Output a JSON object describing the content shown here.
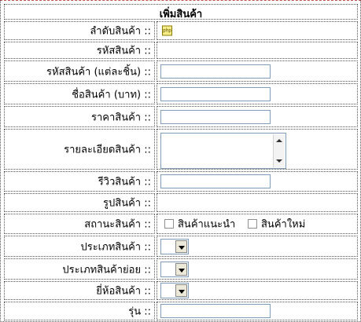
{
  "form": {
    "title": "เพิ่มสินค้า",
    "separator": "::",
    "fields": {
      "order_no": {
        "label": "ลำดับสินค้า",
        "icon": "php-icon"
      },
      "product_code": {
        "label": "รหัสสินค้า"
      },
      "product_code_each": {
        "label": "รหัสสินค้า (แต่ละชิ้น)",
        "value": ""
      },
      "product_name": {
        "label": "ชื่อสินค้า (บาท)",
        "value": ""
      },
      "price": {
        "label": "ราคาสินค้า",
        "value": ""
      },
      "details": {
        "label": "รายละเอียดสินค้า",
        "value": ""
      },
      "review": {
        "label": "รีวิวสินค้า",
        "value": ""
      },
      "image": {
        "label": "รูปสินค้า"
      },
      "status": {
        "label": "สถานะสินค้า",
        "options": [
          {
            "label": "สินค้าแนะนำ",
            "checked": false
          },
          {
            "label": "สินค้าใหม่",
            "checked": false
          }
        ]
      },
      "category": {
        "label": "ประเภทสินค้า",
        "selected": ""
      },
      "subcategory": {
        "label": "ประเภทสินค้าย่อย",
        "selected": ""
      },
      "brand": {
        "label": "ยี่ห้อสินค้า",
        "selected": ""
      },
      "model": {
        "label": "รุ่น",
        "value": ""
      }
    }
  }
}
